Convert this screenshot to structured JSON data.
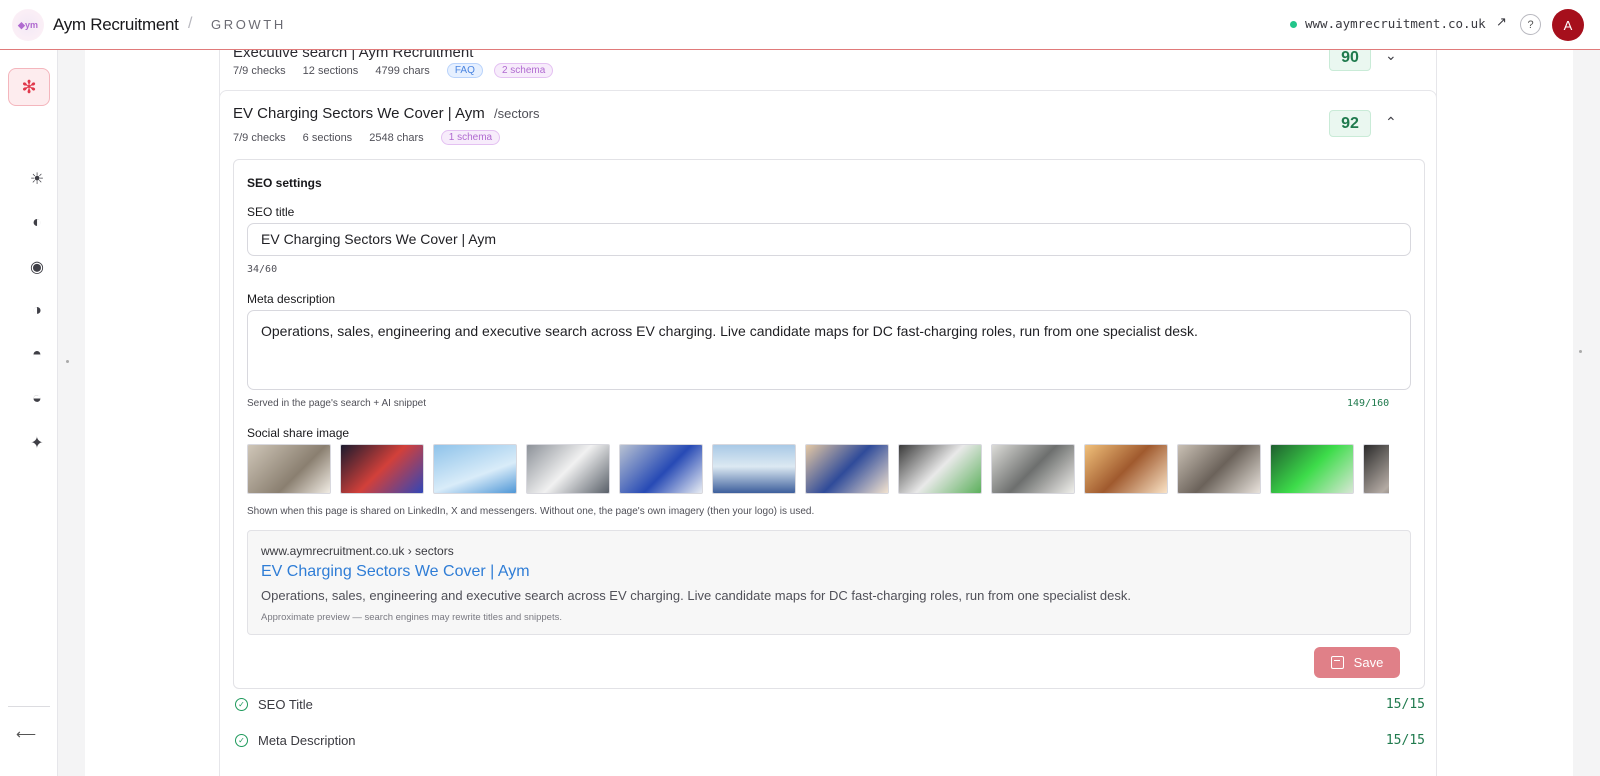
{
  "header": {
    "brand_logo_text": "◆ym",
    "brand_name": "Aym Recruitment",
    "separator": "/",
    "section": "GROWTH",
    "site_url": "www.aymrecruitment.co.uk",
    "external_glyph": "↗",
    "help_glyph": "?",
    "avatar_initial": "A",
    "status_color": "#22c58a"
  },
  "sidebar": {
    "active_icon": "asterisk-icon",
    "icons": [
      {
        "name": "sun-icon",
        "glyph": "☀"
      },
      {
        "name": "half-circle-icon",
        "glyph": "◐"
      },
      {
        "name": "target-icon",
        "glyph": "◉"
      },
      {
        "name": "contrast-icon",
        "glyph": "◑"
      },
      {
        "name": "top-half-circle-icon",
        "glyph": "◓"
      },
      {
        "name": "bottom-half-circle-icon",
        "glyph": "◒"
      },
      {
        "name": "sparkle-icon",
        "glyph": "✦"
      }
    ],
    "collapse_glyph": "⟵"
  },
  "previous_page": {
    "title": "Executive search | Aym Recruitment",
    "checks": "7/9 checks",
    "sections": "12 sections",
    "chars": "4799 chars",
    "pills": [
      "FAQ",
      "2 schema"
    ],
    "score": "90"
  },
  "current_page": {
    "title": "EV Charging Sectors We Cover | Aym",
    "path": "/sectors",
    "checks": "7/9 checks",
    "sections": "6 sections",
    "chars": "2548 chars",
    "pills": [
      "1 schema"
    ],
    "score": "92"
  },
  "seo": {
    "heading": "SEO settings",
    "title_label": "SEO title",
    "title_value": "EV Charging Sectors We Cover | Aym",
    "title_counter": "34/60",
    "desc_label": "Meta description",
    "desc_value": "Operations, sales, engineering and executive search across EV charging. Live candidate maps for DC fast-charging roles, run from one specialist desk.",
    "desc_help": "Served in the page's search + AI snippet",
    "desc_counter": "149/160",
    "image_label": "Social share image",
    "image_help": "Shown when this page is shared on LinkedIn, X and messengers. Without one, the page's own imagery (then your logo) is used.",
    "images": [
      {
        "name": "thumb-ev-charger-plug",
        "bg": "linear-gradient(135deg,#cfc6b8,#8a7f70 60%,#f1ece4)"
      },
      {
        "name": "thumb-neon-charger",
        "bg": "linear-gradient(135deg,#1b1b2e,#d2403a 50%,#3146b8)"
      },
      {
        "name": "thumb-pylon-sky",
        "bg": "linear-gradient(160deg,#8fc3ea,#d9ecf9 60%,#4f97d6)"
      },
      {
        "name": "thumb-street-charger",
        "bg": "linear-gradient(135deg,#8d9299,#f1f1f1 50%,#596069)"
      },
      {
        "name": "thumb-blue-plug",
        "bg": "linear-gradient(135deg,#b8c2d2,#274ab5 55%,#e9edf3)"
      },
      {
        "name": "thumb-solar-panels",
        "bg": "linear-gradient(180deg,#a9c9e6,#dce9f2 45%,#3d5f9c)"
      },
      {
        "name": "thumb-woman-office",
        "bg": "linear-gradient(135deg,#e4c8a4,#2f4b9a 50%,#f3e3cf)"
      },
      {
        "name": "thumb-parking-chargers",
        "bg": "linear-gradient(135deg,#3a3a3a,#e9e9e9 50%,#5cb05c)"
      },
      {
        "name": "thumb-open-office",
        "bg": "linear-gradient(135deg,#dcdcd8,#6d6f6e 50%,#f0f0ec)"
      },
      {
        "name": "thumb-team-meeting",
        "bg": "linear-gradient(135deg,#f0c07a,#a05a2e 50%,#fae3c6)"
      },
      {
        "name": "thumb-desk-team",
        "bg": "linear-gradient(135deg,#c9c0b4,#6b625a 50%,#e9e3dc)"
      },
      {
        "name": "thumb-green-garage",
        "bg": "linear-gradient(135deg,#1f5f2f,#3ddc4a 50%,#d8e7d5)"
      },
      {
        "name": "thumb-charging-car",
        "bg": "linear-gradient(135deg,#2b2b2b,#b3aaa3 50%,#151515)"
      }
    ],
    "preview": {
      "url": "www.aymrecruitment.co.uk › sectors",
      "title": "EV Charging Sectors We Cover | Aym",
      "desc": "Operations, sales, engineering and executive search across EV charging. Live candidate maps for DC fast-charging roles, run from one specialist desk.",
      "note": "Approximate preview — search engines may rewrite titles and snippets."
    },
    "save_label": "Save"
  },
  "checks": [
    {
      "label": "SEO Title",
      "score": "15/15"
    },
    {
      "label": "Meta Description",
      "score": "15/15"
    }
  ]
}
